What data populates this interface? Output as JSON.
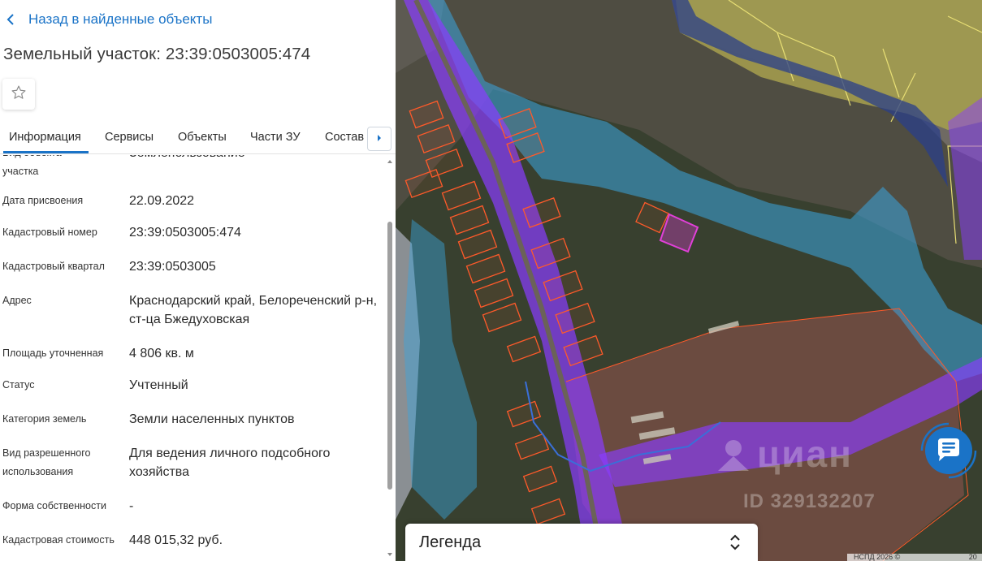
{
  "nav": {
    "back_label": "Назад в найденные объекты"
  },
  "object": {
    "title": "Земельный участок: 23:39:0503005:474"
  },
  "tabs": [
    {
      "label": "Информация",
      "active": true
    },
    {
      "label": "Сервисы"
    },
    {
      "label": "Объекты"
    },
    {
      "label": "Части ЗУ"
    },
    {
      "label": "Состав"
    }
  ],
  "info_rows": [
    {
      "label": "Вид объекта недвижимости участка",
      "label_visible": "участка",
      "value": "Землепользование"
    },
    {
      "label": "Дата присвоения",
      "value": "22.09.2022"
    },
    {
      "label": "Кадастровый номер",
      "value": "23:39:0503005:474"
    },
    {
      "label": "Кадастровый квартал",
      "value": "23:39:0503005"
    },
    {
      "label": "Адрес",
      "value": "Краснодарский край, Белореченский р-н, ст-ца Бжедуховская"
    },
    {
      "label": "Площадь уточненная",
      "value": "4 806 кв. м"
    },
    {
      "label": "Статус",
      "value": "Учтенный"
    },
    {
      "label": "Категория земель",
      "value": "Земли населенных пунктов"
    },
    {
      "label": "Вид разрешенного использования",
      "value": "Для ведения личного подсобного хозяйства"
    },
    {
      "label": "Форма собственности",
      "value": "-"
    },
    {
      "label": "Кадастровая стоимость",
      "value": "448 015,32 руб."
    }
  ],
  "map": {
    "legend_label": "Легенда",
    "watermark": "циан",
    "watermark_id": "ID 329132207",
    "attribution": "НСПД 2026 ©",
    "attribution_right": "20"
  },
  "icons": {
    "back": "chevron-left-icon",
    "favorite": "star-outline-icon",
    "tabs_next": "caret-right-icon",
    "chat": "chat-bubble-icon",
    "legend_toggle": "chevron-up-down-icon"
  },
  "colors": {
    "accent": "#1a73c7",
    "parcel_outline": "#ff5a2a",
    "selected_parcel": "#e040d8",
    "water_zone": "#3aa6e0",
    "road_zone": "#8a3cff",
    "territory": "#c9c257"
  }
}
